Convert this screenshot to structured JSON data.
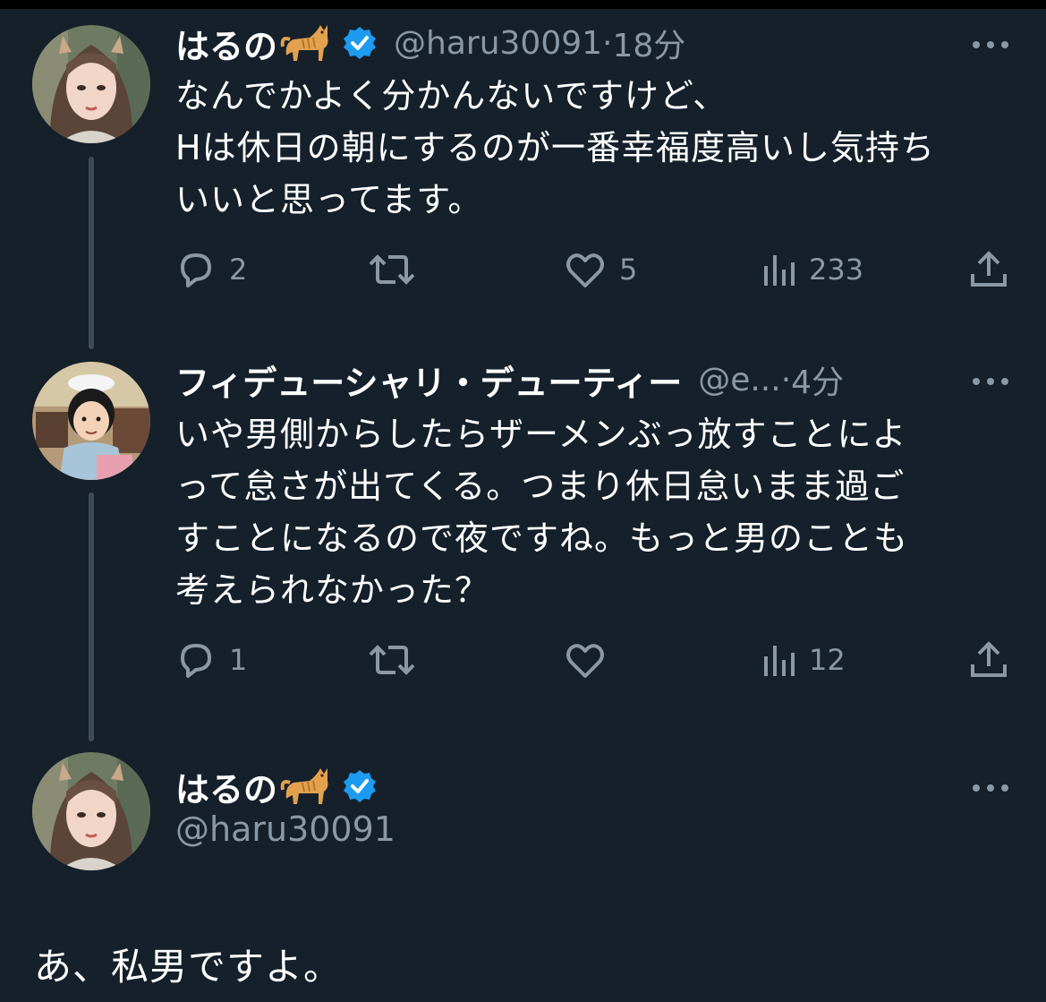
{
  "theme": {
    "background": "#15202b",
    "text_primary": "#ffffff",
    "text_secondary": "#8b98a5",
    "verified_color": "#1d9bf0",
    "thread_line": "#3d4b5a"
  },
  "tweets": [
    {
      "name": "はるの",
      "name_emoji": "cat-icon",
      "verified": true,
      "handle": "@haru30091",
      "separator": "·",
      "time": "18分",
      "text": "なんでかよく分かんないですけど、\nHは休日の朝にするのが一番幸福度高いし気持ち\nいいと思ってます。",
      "replies": "2",
      "retweets": "",
      "likes": "5",
      "views": "233"
    },
    {
      "name": "フィデューシャリ・デューティー",
      "verified": false,
      "handle": "@e...",
      "separator": "·",
      "time": "4分",
      "text": "いや男側からしたらザーメンぶっ放すことによ\nって怠さが出てくる。つまり休日怠いまま過ご\nすことになるので夜ですね。もっと男のことも\n考えられなかった？",
      "replies": "1",
      "retweets": "",
      "likes": "",
      "views": "12"
    }
  ],
  "focused_tweet": {
    "name": "はるの",
    "name_emoji": "cat-icon",
    "verified": true,
    "handle": "@haru30091",
    "text": "あ、私男ですよ。"
  }
}
